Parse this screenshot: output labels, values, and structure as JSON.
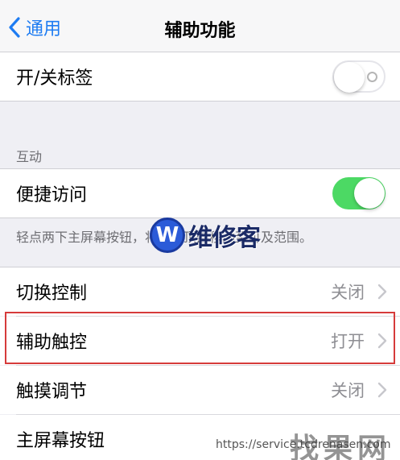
{
  "navbar": {
    "back_label": "通用",
    "title": "辅助功能"
  },
  "rows": {
    "tab_labels": {
      "label": "开/关标签",
      "toggle": "off"
    },
    "reachability": {
      "label": "便捷访问",
      "toggle": "on"
    },
    "switch_control": {
      "label": "切换控制",
      "value": "关闭"
    },
    "assistive_touch": {
      "label": "辅助触控",
      "value": "打开"
    },
    "touch_accommodations": {
      "label": "触摸调节",
      "value": "关闭"
    },
    "home_button": {
      "label": "主屏幕按钮"
    }
  },
  "sections": {
    "interaction_header": "互动",
    "reachability_footer": "轻点两下主屏幕按钮，将屏幕顶部移动至可及范围。"
  },
  "watermark": {
    "logo_letter": "W",
    "logo_text": "维修客",
    "url": "https://service.tcdrenasen.com",
    "brand": "找果网"
  },
  "colors": {
    "accent": "#1e7cf2",
    "toggle_on": "#4cd964",
    "highlight": "#d63b3b"
  }
}
